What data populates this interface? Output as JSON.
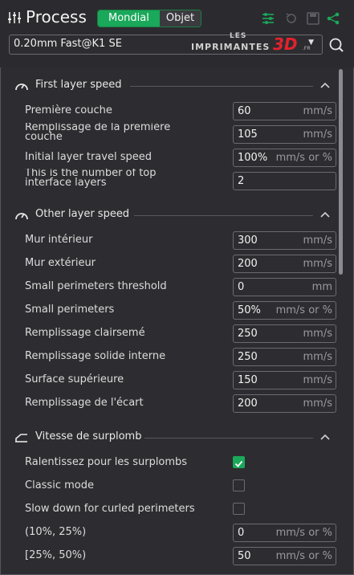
{
  "header": {
    "title": "Process",
    "mode_tabs": [
      {
        "label": "Mondial",
        "active": true
      },
      {
        "label": "Objet",
        "active": false
      }
    ],
    "icons": [
      "settings-list-icon",
      "undo-icon",
      "save-icon",
      "compare-icon"
    ]
  },
  "preset": {
    "value": "0.20mm Fast@K1 SE",
    "watermark": {
      "les": "LES",
      "brand": "IMPRIMANTES",
      "highlight": "3D",
      "tld": ".FR"
    }
  },
  "sections": [
    {
      "title": "First layer speed",
      "rows": [
        {
          "label": "Première couche",
          "value": "60",
          "unit": "mm/s",
          "type": "input"
        },
        {
          "label": "Remplissage de la première couche",
          "value": "105",
          "unit": "mm/s",
          "type": "input",
          "wrap": true
        },
        {
          "label": "Initial layer travel speed",
          "value": "100%",
          "unit": "mm/s or %",
          "type": "input"
        },
        {
          "label": "This is the number of top interface layers",
          "value": "2",
          "unit": "",
          "type": "input",
          "wrap": true
        }
      ]
    },
    {
      "title": "Other layer speed",
      "rows": [
        {
          "label": "Mur intérieur",
          "value": "300",
          "unit": "mm/s",
          "type": "input"
        },
        {
          "label": "Mur extérieur",
          "value": "200",
          "unit": "mm/s",
          "type": "input"
        },
        {
          "label": "Small perimeters threshold",
          "value": "0",
          "unit": "mm",
          "type": "input"
        },
        {
          "label": "Small perimeters",
          "value": "50%",
          "unit": "mm/s or %",
          "type": "input"
        },
        {
          "label": "Remplissage clairsemé",
          "value": "250",
          "unit": "mm/s",
          "type": "input"
        },
        {
          "label": "Remplissage solide interne",
          "value": "250",
          "unit": "mm/s",
          "type": "input"
        },
        {
          "label": "Surface supérieure",
          "value": "150",
          "unit": "mm/s",
          "type": "input"
        },
        {
          "label": "Remplissage de l'écart",
          "value": "200",
          "unit": "mm/s",
          "type": "input"
        }
      ]
    },
    {
      "title": "Vitesse de surplomb",
      "rows": [
        {
          "label": "Ralentissez pour les surplombs",
          "checked": true,
          "type": "checkbox"
        },
        {
          "label": "Classic mode",
          "checked": false,
          "type": "checkbox"
        },
        {
          "label": "Slow down for curled perimeters",
          "checked": false,
          "type": "checkbox"
        },
        {
          "label": "(10%, 25%)",
          "value": "0",
          "unit": "mm/s or %",
          "type": "input"
        },
        {
          "label": "[25%, 50%)",
          "value": "50",
          "unit": "mm/s or %",
          "type": "input"
        }
      ]
    }
  ],
  "colors": {
    "accent": "#1aa85a",
    "background": "#2d2d31",
    "brand_red": "#e3222c"
  }
}
